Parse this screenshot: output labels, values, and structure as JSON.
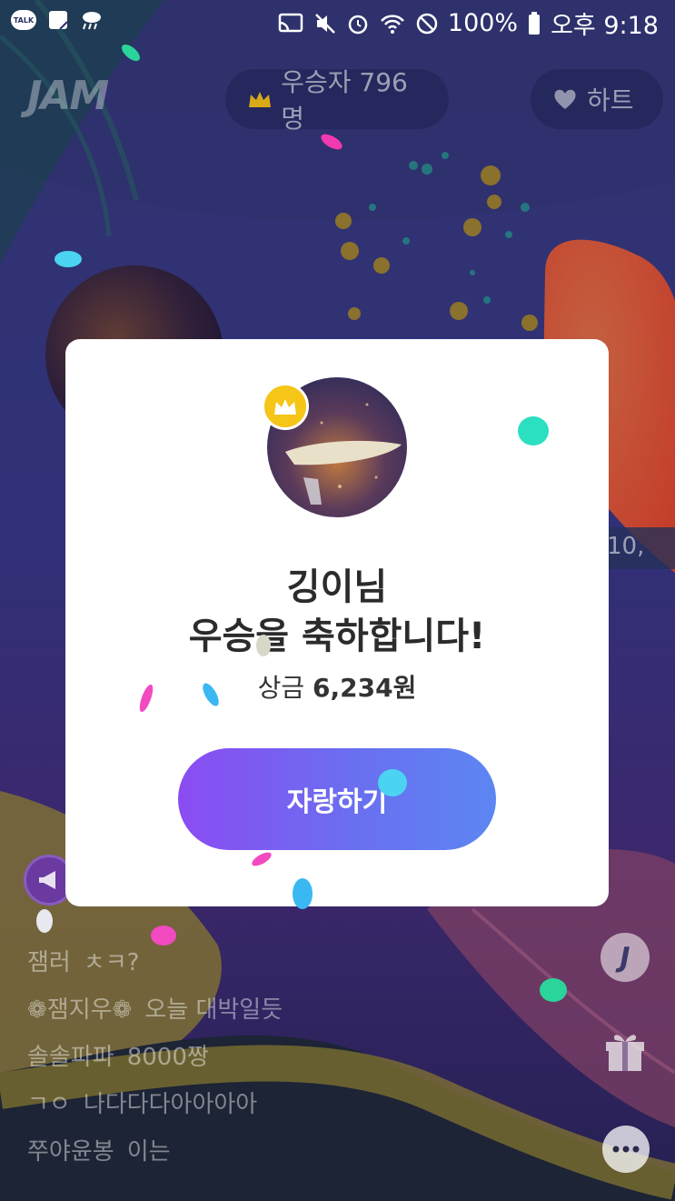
{
  "status_bar": {
    "battery": "100%",
    "time": "오후 9:18",
    "talk_badge": "TALK"
  },
  "header": {
    "logo": "JAM",
    "winners_label": "우승자 796명",
    "heart_label": "하트"
  },
  "partial_text": "10,",
  "modal": {
    "name_line": "깅이님",
    "congrats_line": "우승을 축하합니다!",
    "prize_label": "상금",
    "prize_amount": "6,234원",
    "share_button": "자랑하기"
  },
  "chat": [
    {
      "user": "잼러",
      "message": "ㅊㅋ?"
    },
    {
      "user": "❁잼지우❁",
      "message": "오늘 대박일듯"
    },
    {
      "user": "솔솔파파",
      "message": "8000짱"
    },
    {
      "user": "ㄱㅇ",
      "message": "나다다다아아아아"
    },
    {
      "user": "쭈야윤봉",
      "message": "이는"
    }
  ],
  "colors": {
    "accent_crown": "#f5c518",
    "button_start": "#8b4cf2",
    "button_end": "#5c86f2",
    "balloon": "#ff5a36"
  }
}
